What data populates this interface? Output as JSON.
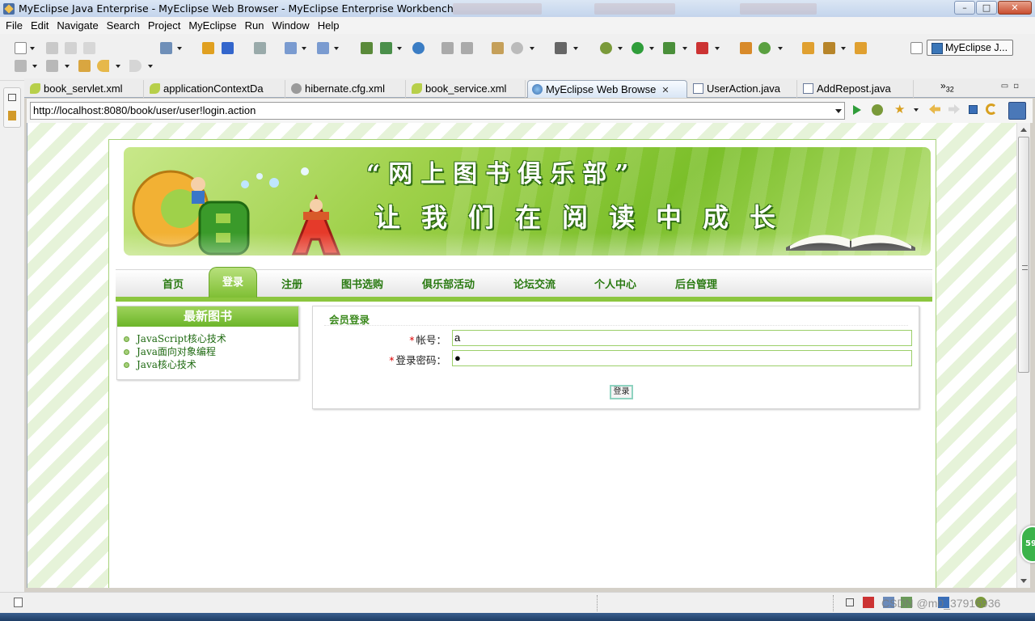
{
  "window": {
    "title": "MyEclipse Java Enterprise - MyEclipse Web Browser - MyEclipse Enterprise Workbench",
    "minimize": "–",
    "maximize": "□",
    "close": "✕"
  },
  "menu": [
    "File",
    "Edit",
    "Navigate",
    "Search",
    "Project",
    "MyEclipse",
    "Run",
    "Window",
    "Help"
  ],
  "perspective": "MyEclipse J...",
  "tabs": [
    {
      "label": "book_servlet.xml",
      "icon": "xml-file-icon"
    },
    {
      "label": "applicationContextDa",
      "icon": "xml-file-icon"
    },
    {
      "label": "hibernate.cfg.xml",
      "icon": "hibernate-icon"
    },
    {
      "label": "book_service.xml",
      "icon": "xml-file-icon"
    },
    {
      "label": "MyEclipse Web Browse",
      "icon": "globe-icon"
    },
    {
      "label": "UserAction.java",
      "icon": "java-file-icon"
    },
    {
      "label": "AddRepost.java",
      "icon": "java-file-icon"
    }
  ],
  "tabs_overflow": "32",
  "browser": {
    "url": "http://localhost:8080/book/user/user!login.action"
  },
  "banner": {
    "line1": "“网上图书俱乐部”",
    "line2": "让我们在阅读中成长",
    "letters": "CBA"
  },
  "nav": [
    "首页",
    "登录",
    "注册",
    "图书选购",
    "俱乐部活动",
    "论坛交流",
    "个人中心",
    "后台管理"
  ],
  "nav_active": "登录",
  "latest_books": {
    "title": "最新图书",
    "items": [
      "JavaScript核心技术",
      "Java面向对象编程",
      "Java核心技术"
    ]
  },
  "login": {
    "title": "会员登录",
    "account_label": "帐号：",
    "account_value": "a",
    "password_label": "登录密码：",
    "password_value": "●",
    "required_mark": "*",
    "submit_label": "登录"
  },
  "statusbar": {
    "watermark": "CSDN @m0_37916936"
  },
  "floating_badge": "59",
  "colors": {
    "nav_text": "#2a7a12",
    "accent_green": "#8cc63f",
    "required": "#dd0000"
  }
}
